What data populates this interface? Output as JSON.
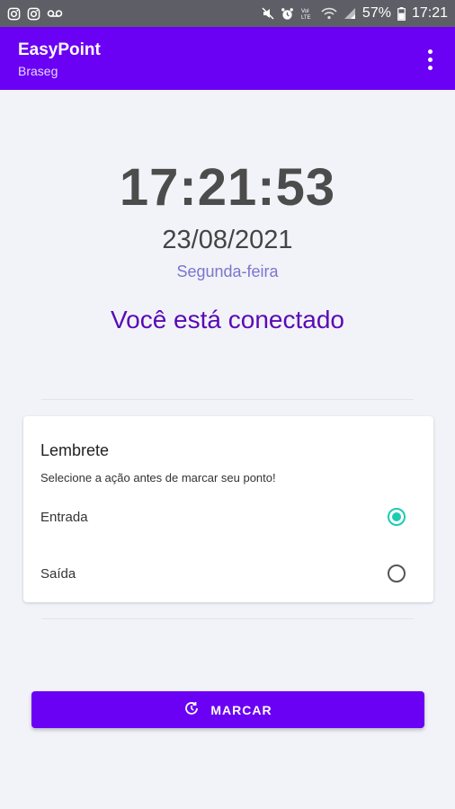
{
  "statusbar": {
    "battery": "57%",
    "time": "17:21",
    "icons_left": [
      "instagram-icon",
      "instagram-icon",
      "voicemail-icon"
    ],
    "icons_right": [
      "mute-icon",
      "alarm-icon",
      "volte-icon",
      "wifi-icon",
      "signal-icon",
      "battery-icon"
    ]
  },
  "appbar": {
    "title": "EasyPoint",
    "subtitle": "Braseg",
    "menu_icon": "more-vert-icon",
    "color": "#6a00f4"
  },
  "clock": {
    "time": "17:21:53",
    "date": "23/08/2021",
    "weekday": "Segunda-feira"
  },
  "status": {
    "text": "Você está conectado",
    "color": "#5a0ab5"
  },
  "reminder": {
    "title": "Lembrete",
    "description": "Selecione a ação antes de marcar seu ponto!",
    "options": [
      {
        "label": "Entrada",
        "selected": true
      },
      {
        "label": "Saída",
        "selected": false
      }
    ],
    "accent": "#1ccbb4"
  },
  "action": {
    "label": "MARCAR",
    "icon": "clock-refresh-icon"
  }
}
